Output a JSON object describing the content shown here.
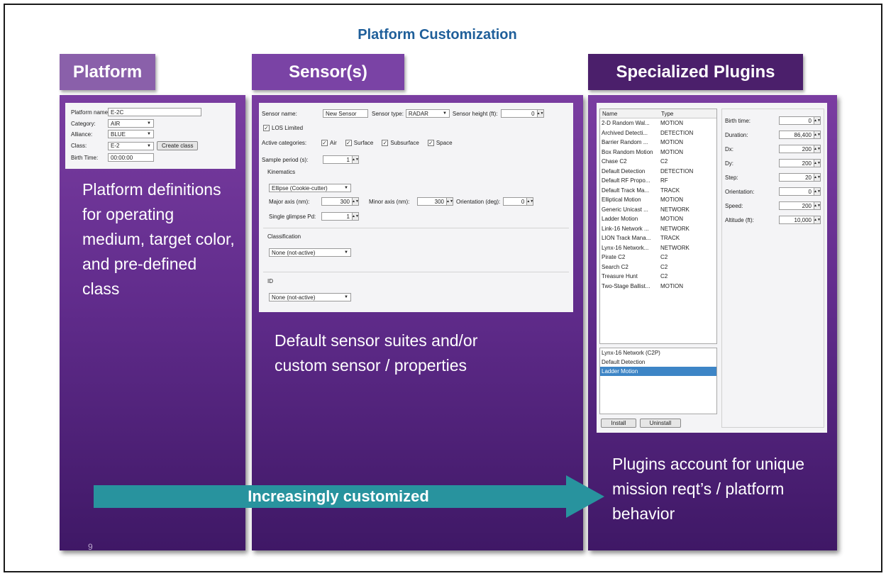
{
  "slide": {
    "title": "Platform Customization",
    "page_number": "9"
  },
  "headers": {
    "platform": "Platform",
    "sensor": "Sensor(s)",
    "plugins": "Specialized Plugins"
  },
  "captions": {
    "platform": "Platform definitions for operating medium, target color, and pre-defined class",
    "sensor": "Default sensor suites and/or custom sensor / properties",
    "plugins": "Plugins account for unique mission reqt’s / platform behavior"
  },
  "arrow": {
    "label": "Increasingly customized",
    "color": "#28939e"
  },
  "platform_form": {
    "name_label": "Platform name:",
    "name_value": "E-2C",
    "category_label": "Category:",
    "category_value": "AIR",
    "alliance_label": "Alliance:",
    "alliance_value": "BLUE",
    "class_label": "Class:",
    "class_value": "E-2",
    "create_class": "Create class",
    "birth_label": "Birth Time:",
    "birth_value": "00:00:00"
  },
  "sensor_form": {
    "name_label": "Sensor name:",
    "name_value": "New Sensor",
    "type_label": "Sensor type:",
    "type_value": "RADAR",
    "height_label": "Sensor height (ft):",
    "height_value": "0",
    "los_label": "LOS Limited",
    "active_label": "Active categories:",
    "categories": [
      "Air",
      "Surface",
      "Subsurface",
      "Space"
    ],
    "sample_label": "Sample period (s):",
    "sample_value": "1",
    "kinematics_label": "Kinematics",
    "kinematics_value": "Ellipse (Cookie-cutter)",
    "major_label": "Major axis (nm):",
    "major_value": "300",
    "minor_label": "Minor axis (nm):",
    "minor_value": "300",
    "orient_label": "Orientation (deg):",
    "orient_value": "0",
    "glimpse_label": "Single glimpse Pd:",
    "glimpse_value": "1",
    "classification_label": "Classification",
    "classification_value": "None (not-active)",
    "id_label": "ID",
    "id_value": "None (not-active)"
  },
  "plugins_form": {
    "col_name": "Name",
    "col_type": "Type",
    "rows": [
      {
        "name": "2-D Random Wal...",
        "type": "MOTION"
      },
      {
        "name": "Archived Detecti...",
        "type": "DETECTION"
      },
      {
        "name": "Barrier Random ...",
        "type": "MOTION"
      },
      {
        "name": "Box Random Motion",
        "type": "MOTION"
      },
      {
        "name": "Chase C2",
        "type": "C2"
      },
      {
        "name": "Default Detection",
        "type": "DETECTION"
      },
      {
        "name": "Default RF Propo...",
        "type": "RF"
      },
      {
        "name": "Default Track Ma...",
        "type": "TRACK"
      },
      {
        "name": "Elliptical Motion",
        "type": "MOTION"
      },
      {
        "name": "Generic Unicast ...",
        "type": "NETWORK"
      },
      {
        "name": "Ladder Motion",
        "type": "MOTION"
      },
      {
        "name": "Link-16 Network ...",
        "type": "NETWORK"
      },
      {
        "name": "LION Track Mana...",
        "type": "TRACK"
      },
      {
        "name": "Lynx-16 Network...",
        "type": "NETWORK"
      },
      {
        "name": "Pirate C2",
        "type": "C2"
      },
      {
        "name": "Search C2",
        "type": "C2"
      },
      {
        "name": "Treasure Hunt",
        "type": "C2"
      },
      {
        "name": "Two-Stage Ballist...",
        "type": "MOTION"
      }
    ],
    "installed": [
      "Lynx-16 Network (C2P)",
      "Default Detection",
      "Ladder Motion"
    ],
    "install_button": "Install",
    "uninstall_button": "Uninstall",
    "props": [
      {
        "label": "Birth time:",
        "value": "0"
      },
      {
        "label": "Duration:",
        "value": "86,400"
      },
      {
        "label": "Dx:",
        "value": "200"
      },
      {
        "label": "Dy:",
        "value": "200"
      },
      {
        "label": "Step:",
        "value": "20"
      },
      {
        "label": "Orientation:",
        "value": "0"
      },
      {
        "label": "Speed:",
        "value": "200"
      },
      {
        "label": "Altitude (ft):",
        "value": "10,000"
      }
    ]
  }
}
